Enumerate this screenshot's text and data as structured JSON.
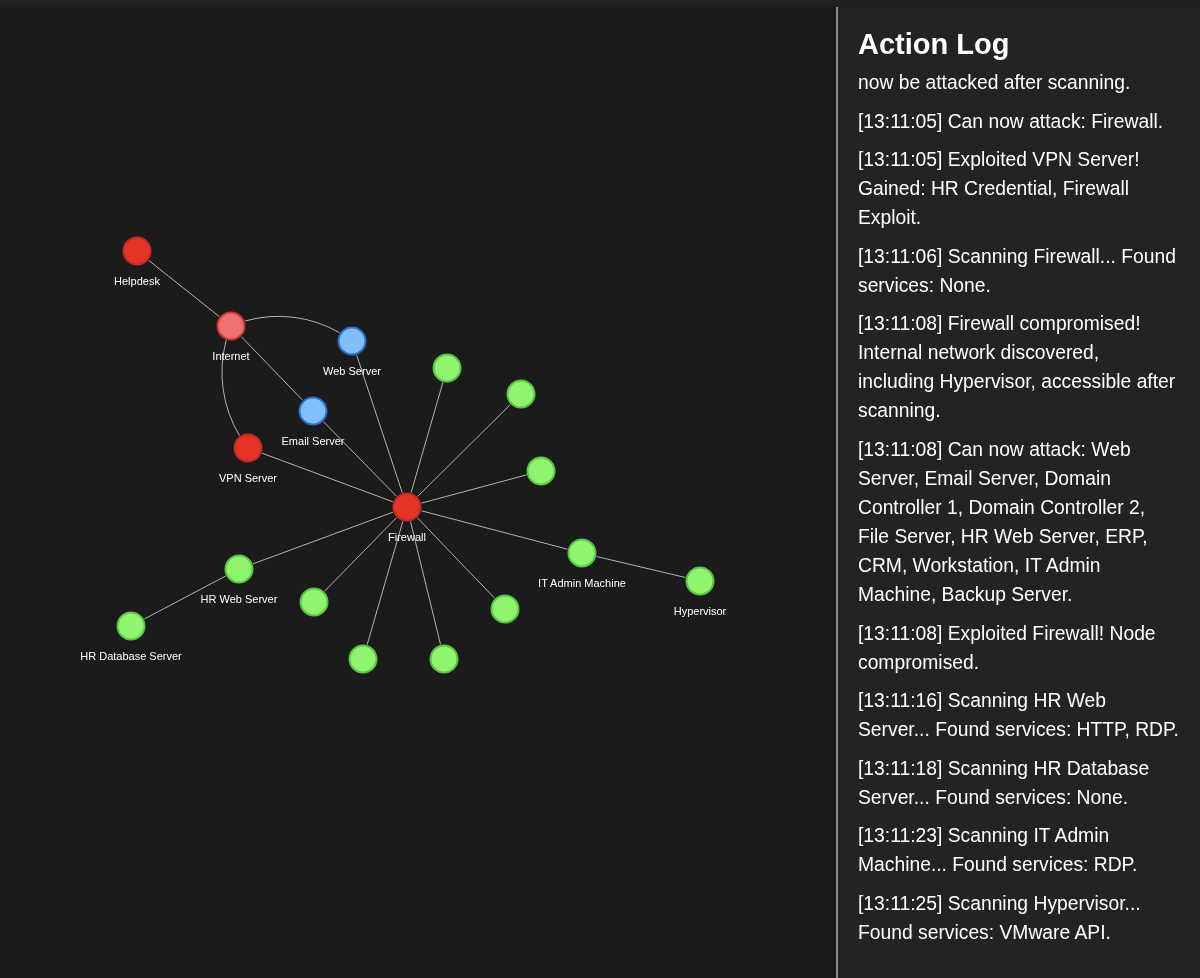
{
  "graph": {
    "nodes": [
      {
        "label": "Helpdesk",
        "color": "#e5352a"
      },
      {
        "label": "Internet",
        "color": "#ef7272"
      },
      {
        "label": "Web Server",
        "color": "#80c0fa"
      },
      {
        "label": "Email Server",
        "color": "#80c0fa"
      },
      {
        "label": "VPN Server",
        "color": "#e5352a"
      },
      {
        "label": "Firewall",
        "color": "#e5352a"
      },
      {
        "color": "#8ff56f"
      },
      {
        "color": "#8ff56f"
      },
      {
        "color": "#8ff56f"
      },
      {
        "label": "IT Admin Machine",
        "color": "#8ff56f"
      },
      {
        "label": "Hypervisor",
        "color": "#8ff56f"
      },
      {
        "label": "HR Web Server",
        "color": "#8ff56f"
      },
      {
        "label": "HR Database Server",
        "color": "#8ff56f"
      },
      {
        "color": "#8ff56f"
      },
      {
        "color": "#8ff56f"
      },
      {
        "color": "#8ff56f"
      },
      {
        "color": "#8ff56f"
      }
    ]
  },
  "action_log": {
    "title": "Action Log",
    "entries": [
      "now be attacked after scanning.",
      "[13:11:05] Can now attack: Firewall.",
      "[13:11:05] Exploited VPN Server! Gained: HR Credential, Firewall Exploit.",
      "[13:11:06] Scanning Firewall... Found services: None.",
      "[13:11:08] Firewall compromised! Internal network discovered, including Hypervisor, accessible after scanning.",
      "[13:11:08] Can now attack: Web Server, Email Server, Domain Controller 1, Domain Controller 2, File Server, HR Web Server, ERP, CRM, Workstation, IT Admin Machine, Backup Server.",
      "[13:11:08] Exploited Firewall! Node compromised.",
      "[13:11:16] Scanning HR Web Server... Found services: HTTP, RDP.",
      "[13:11:18] Scanning HR Database Server... Found services: None.",
      "[13:11:23] Scanning IT Admin Machine... Found services: RDP.",
      "[13:11:25] Scanning Hypervisor... Found services: VMware API."
    ]
  }
}
